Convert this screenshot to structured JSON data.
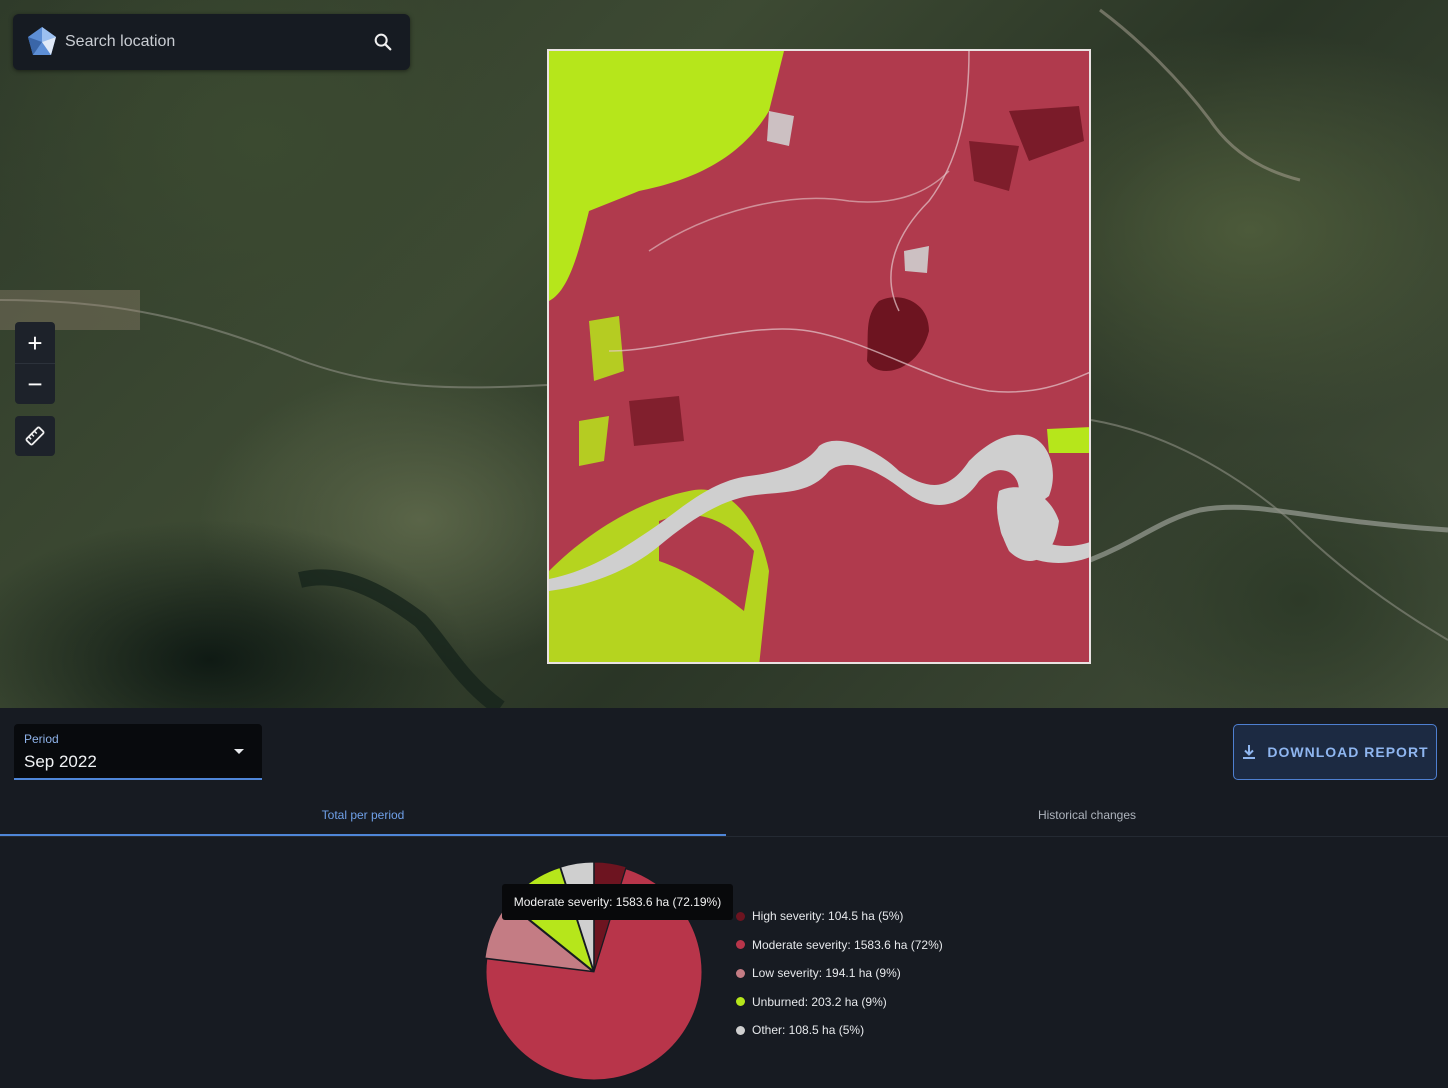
{
  "search": {
    "placeholder": "Search location"
  },
  "map_controls": {
    "zoom_in": "+",
    "zoom_out": "−"
  },
  "period": {
    "label": "Period",
    "value": "Sep 2022"
  },
  "download_button": {
    "label": "DOWNLOAD REPORT"
  },
  "tabs": [
    {
      "label": "Total per period",
      "active": true
    },
    {
      "label": "Historical changes",
      "active": false
    }
  ],
  "tooltip": {
    "text": "Moderate severity: 1583.6 ha (72.19%)"
  },
  "colors": {
    "high": "#6d1420",
    "moderate": "#b8354a",
    "low": "#c47c84",
    "unburned": "#b6e61b",
    "other": "#cfcfcf",
    "accent": "#4f86d8"
  },
  "chart_data": {
    "type": "pie",
    "slices": [
      {
        "name": "High severity",
        "value": 104.5,
        "percent": 5,
        "color": "#6d1420",
        "label": "High severity: 104.5 ha (5%)"
      },
      {
        "name": "Moderate severity",
        "value": 1583.6,
        "percent": 72,
        "color": "#b8354a",
        "label": "Moderate severity: 1583.6 ha (72%)"
      },
      {
        "name": "Low severity",
        "value": 194.1,
        "percent": 9,
        "color": "#c47c84",
        "label": "Low severity: 194.1 ha (9%)"
      },
      {
        "name": "Unburned",
        "value": 203.2,
        "percent": 9,
        "color": "#b6e61b",
        "label": "Unburned: 203.2 ha (9%)"
      },
      {
        "name": "Other",
        "value": 108.5,
        "percent": 5,
        "color": "#cfcfcf",
        "label": "Other: 108.5 ha (5%)"
      }
    ],
    "legend_position": "right"
  }
}
